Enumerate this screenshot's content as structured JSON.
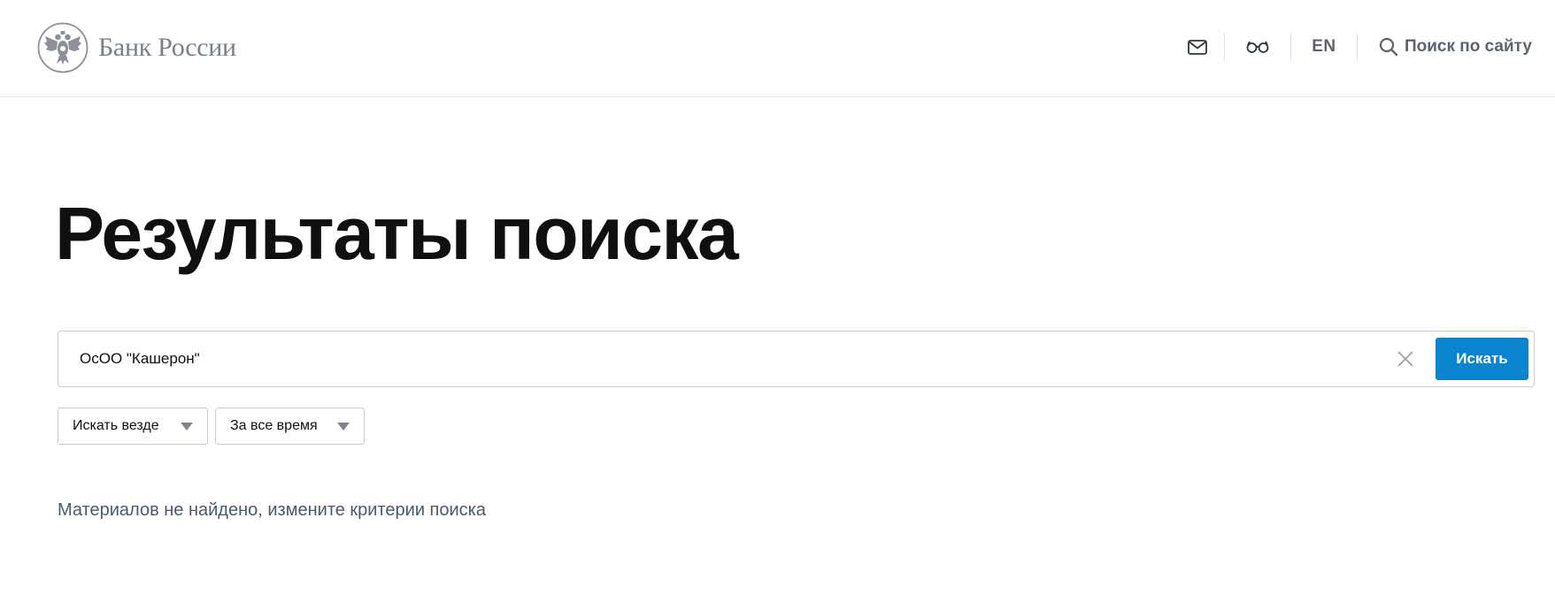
{
  "header": {
    "logo_text": "Банк России",
    "tools": {
      "mail_icon": "mail-icon",
      "glasses_icon": "glasses-icon",
      "lang_label": "EN",
      "search_label": "Поиск по сайту",
      "search_icon": "search-icon"
    }
  },
  "main": {
    "title": "Результаты поиска",
    "search": {
      "value": "ОсОО \"Кашерон\"",
      "submit_label": "Искать",
      "clear_icon": "close-icon"
    },
    "filters": [
      {
        "label": "Искать везде"
      },
      {
        "label": "За все время"
      }
    ],
    "no_results_text": "Материалов не найдено, измените критерии поиска"
  },
  "colors": {
    "accent": "#0a84cf",
    "muted_text": "#4a5a6c",
    "header_text": "#5b6470"
  }
}
